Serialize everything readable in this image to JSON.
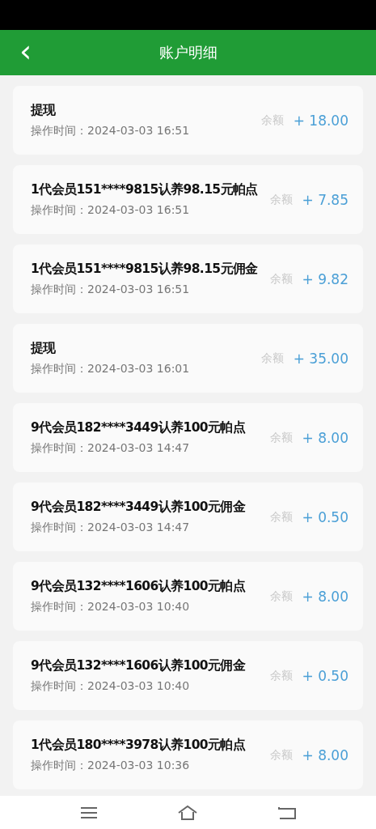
{
  "header": {
    "back": "‹",
    "title": "账户明细"
  },
  "records": [
    {
      "title": "提现",
      "time": "操作时间：2024-03-03 16:51",
      "label": "余额",
      "amount": "+ 18.00"
    },
    {
      "title": "1代会员151****9815认养98.15元帕点",
      "time": "操作时间：2024-03-03 16:51",
      "label": "余额",
      "amount": "+ 7.85"
    },
    {
      "title": "1代会员151****9815认养98.15元佣金",
      "time": "操作时间：2024-03-03 16:51",
      "label": "余额",
      "amount": "+ 9.82"
    },
    {
      "title": "提现",
      "time": "操作时间：2024-03-03 16:01",
      "label": "余额",
      "amount": "+ 35.00"
    },
    {
      "title": "9代会员182****3449认养100元帕点",
      "time": "操作时间：2024-03-03 14:47",
      "label": "余额",
      "amount": "+ 8.00"
    },
    {
      "title": "9代会员182****3449认养100元佣金",
      "time": "操作时间：2024-03-03 14:47",
      "label": "余额",
      "amount": "+ 0.50"
    },
    {
      "title": "9代会员132****1606认养100元帕点",
      "time": "操作时间：2024-03-03 10:40",
      "label": "余额",
      "amount": "+ 8.00"
    },
    {
      "title": "9代会员132****1606认养100元佣金",
      "time": "操作时间：2024-03-03 10:40",
      "label": "余额",
      "amount": "+ 0.50"
    },
    {
      "title": "1代会员180****3978认养100元帕点",
      "time": "操作时间：2024-03-03 10:36",
      "label": "余额",
      "amount": "+ 8.00"
    }
  ]
}
